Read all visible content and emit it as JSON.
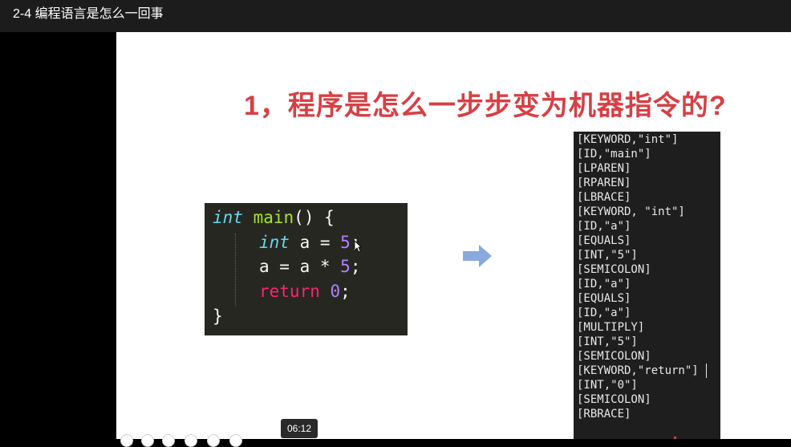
{
  "window": {
    "title": "2-4 编程语言是怎么一回事"
  },
  "slide": {
    "title": "1，程序是怎么一步步变为机器指令的?",
    "code": {
      "line1": {
        "type_kw": "int",
        "name": "main",
        "rest": "() {"
      },
      "line2": {
        "type_kw": "int",
        "mid": "a = ",
        "num": "5",
        "end": ";"
      },
      "line3": {
        "mid": "a = a * ",
        "num": "5",
        "end": ";"
      },
      "line4": {
        "kw": "return",
        "num": "0",
        "end": ";"
      },
      "line5": {
        "text": "}"
      }
    },
    "arrow_icon": "arrow-right-icon",
    "tokens": [
      "[KEYWORD,\"int\"]",
      "[ID,\"main\"]",
      "[LPAREN]",
      "[RPAREN]",
      "[LBRACE]",
      "[KEYWORD, \"int\"]",
      "[ID,\"a\"]",
      "[EQUALS]",
      "[INT,\"5\"]",
      "[SEMICOLON]",
      "[ID,\"a\"]",
      "[EQUALS]",
      "[ID,\"a\"]",
      "[MULTIPLY]",
      "[INT,\"5\"]",
      "[SEMICOLON]",
      "[KEYWORD,\"return\"]",
      "[INT,\"0\"]",
      "[SEMICOLON]",
      "[RBRACE]"
    ]
  },
  "player": {
    "time": "06:12"
  },
  "colors": {
    "title_red": "#d64045",
    "code_bg": "#272722",
    "arrow": "#8aaadf"
  }
}
